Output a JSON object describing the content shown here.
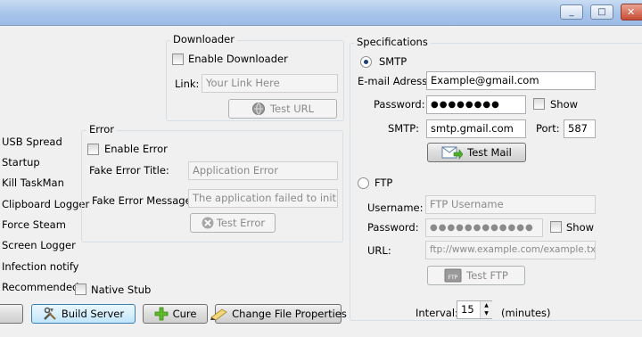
{
  "window": {
    "minimize_glyph": "_",
    "maximize_glyph": "□",
    "close_glyph": "✕"
  },
  "sidebar": {
    "items": [
      "USB Spread",
      "Startup",
      "Kill TaskMan",
      "Clipboard Logger",
      "Force Steam",
      "Screen Logger",
      "Infection notify",
      "Recommended"
    ]
  },
  "downloader": {
    "title": "Downloader",
    "enable_label": "Enable Downloader",
    "link_label": "Link:",
    "link_placeholder": "Your Link Here",
    "test_url_label": "Test URL"
  },
  "error": {
    "title": "Error",
    "enable_label": "Enable Error",
    "fake_title_label": "Fake Error Title:",
    "fake_title_value": "Application Error",
    "fake_message_label": "Fake Error Message:",
    "fake_message_value": "The application failed to initialize properly",
    "test_error_label": "Test Error"
  },
  "native_stub_label": "Native Stub",
  "bottom_buttons": {
    "build_server": "Build Server",
    "cure": "Cure",
    "change_file_properties": "Change File Properties"
  },
  "specifications": {
    "title": "Specifications",
    "smtp_radio_label": "SMTP",
    "email_label": "E-mail Adress:",
    "email_value": "Example@gmail.com",
    "password_label": "Password:",
    "password_value": "●●●●●●●●",
    "show_label": "Show",
    "smtp_label": "SMTP:",
    "smtp_value": "smtp.gmail.com",
    "port_label": "Port:",
    "port_value": "587",
    "test_mail_label": "Test Mail",
    "ftp_radio_label": "FTP",
    "username_label": "Username:",
    "username_placeholder": "FTP Username",
    "ftp_password_label": "Password:",
    "ftp_password_value": "●●●●●●●●●●●●",
    "ftp_show_label": "Show",
    "url_label": "URL:",
    "url_placeholder": "ftp://www.example.com/example.txt",
    "test_ftp_label": "Test FTP",
    "interval_label": "Interval:",
    "interval_value": "15",
    "interval_unit": "(minutes)"
  },
  "colors": {
    "titlebar": "#a7c4ea",
    "accent": "#3c7fb1",
    "close": "#c74b33"
  }
}
